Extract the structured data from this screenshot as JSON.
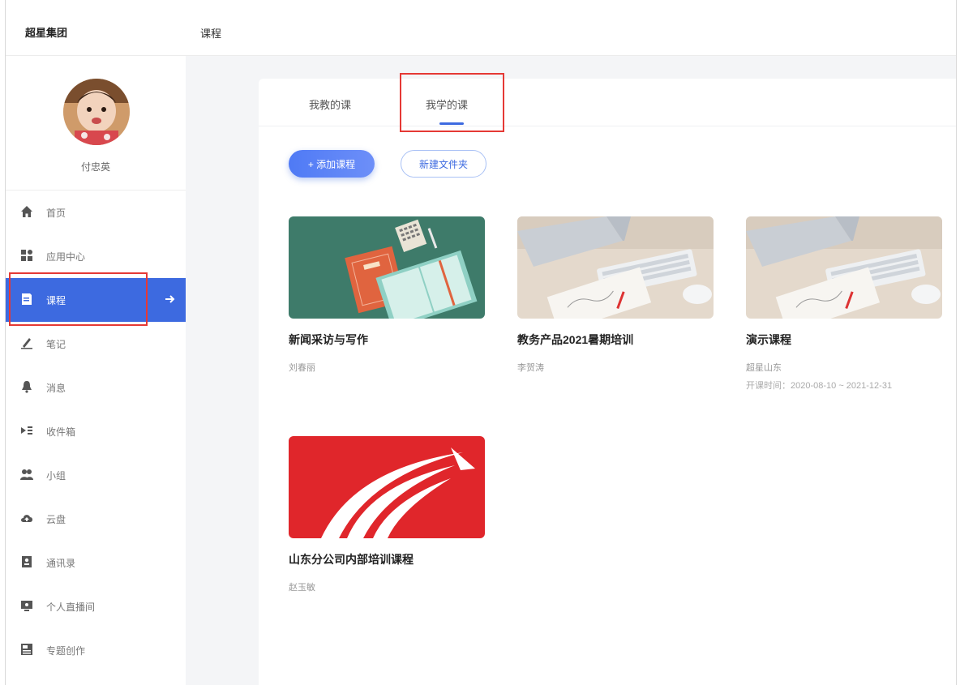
{
  "header": {
    "brand": "超星集团",
    "breadcrumb": "课程"
  },
  "user": {
    "name": "付忠英"
  },
  "sidebar": {
    "items": [
      {
        "label": "首页",
        "icon": "home-icon"
      },
      {
        "label": "应用中心",
        "icon": "apps-icon"
      },
      {
        "label": "课程",
        "icon": "book-icon",
        "active": true
      },
      {
        "label": "笔记",
        "icon": "pen-icon"
      },
      {
        "label": "消息",
        "icon": "bell-icon"
      },
      {
        "label": "收件箱",
        "icon": "inbox-icon"
      },
      {
        "label": "小组",
        "icon": "group-icon"
      },
      {
        "label": "云盘",
        "icon": "cloud-icon"
      },
      {
        "label": "通讯录",
        "icon": "contacts-icon"
      },
      {
        "label": "个人直播间",
        "icon": "live-icon"
      },
      {
        "label": "专题创作",
        "icon": "topic-icon"
      }
    ]
  },
  "tabs": [
    {
      "label": "我教的课",
      "active": false
    },
    {
      "label": "我学的课",
      "active": true
    }
  ],
  "actions": {
    "add_course": "+ 添加课程",
    "new_folder": "新建文件夹"
  },
  "courses": [
    {
      "title": "新闻采访与写作",
      "teacher": "刘春丽",
      "period": "",
      "cover": "books-illustration"
    },
    {
      "title": "教务产品2021暑期培训",
      "teacher": "李贺涛",
      "period": "",
      "cover": "desk-keyboard-photo"
    },
    {
      "title": "演示课程",
      "teacher": "超星山东",
      "period": "开课时间：2020-08-10 ~ 2021-12-31",
      "cover": "desk-keyboard-photo"
    },
    {
      "title": "山东分公司内部培训课程",
      "teacher": "赵玉敏",
      "period": "",
      "cover": "superstar-logo"
    }
  ],
  "colors": {
    "accent": "#3d6ae0",
    "highlight": "#e53935",
    "logo_red": "#e0262b",
    "book_green": "#3e7b6a"
  }
}
